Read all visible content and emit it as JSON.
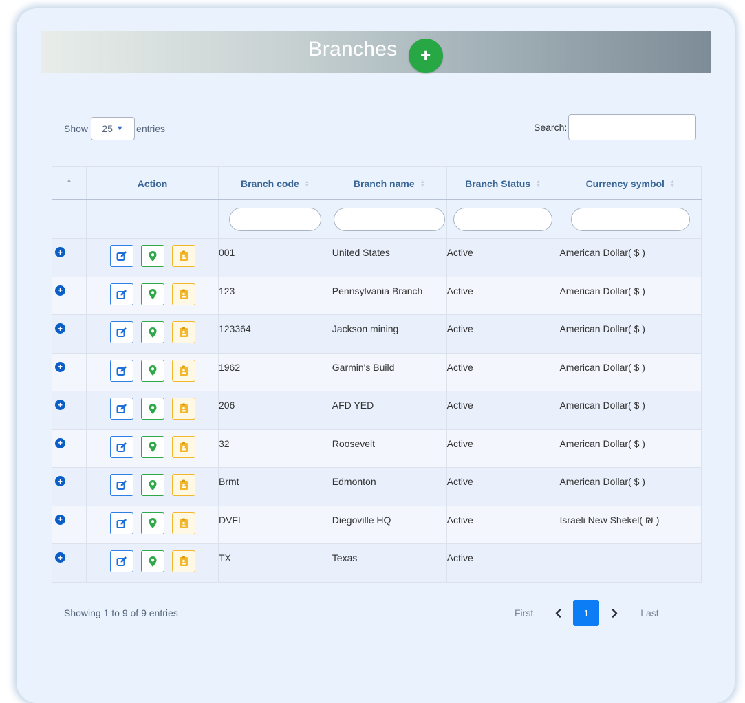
{
  "header": {
    "title": "Branches",
    "add_label": "+"
  },
  "controls": {
    "show_label": "Show",
    "entries_value": "25",
    "entries_label": "entries",
    "search_label": "Search:",
    "search_value": ""
  },
  "table": {
    "columns": [
      "",
      "Action",
      "Branch code",
      "Branch name",
      "Branch Status",
      "Currency symbol"
    ],
    "rows": [
      {
        "code": "001",
        "name": "United States",
        "status": "Active",
        "currency": "American Dollar( $ )"
      },
      {
        "code": "123",
        "name": "Pennsylvania Branch",
        "status": "Active",
        "currency": "American Dollar( $ )"
      },
      {
        "code": "123364",
        "name": "Jackson mining",
        "status": "Active",
        "currency": "American Dollar( $ )"
      },
      {
        "code": "1962",
        "name": "Garmin's Build",
        "status": "Active",
        "currency": "American Dollar( $ )"
      },
      {
        "code": "206",
        "name": "AFD YED",
        "status": "Active",
        "currency": "American Dollar( $ )"
      },
      {
        "code": "32",
        "name": "Roosevelt",
        "status": "Active",
        "currency": "American Dollar( $ )"
      },
      {
        "code": "Brmt",
        "name": "Edmonton",
        "status": "Active",
        "currency": "American Dollar( $ )"
      },
      {
        "code": "DVFL",
        "name": "Diegoville HQ",
        "status": "Active",
        "currency": "Israeli New Shekel( ₪ )"
      },
      {
        "code": "TX",
        "name": "Texas",
        "status": "Active",
        "currency": ""
      }
    ]
  },
  "footer": {
    "info": "Showing 1 to 9 of 9 entries",
    "first": "First",
    "current_page": "1",
    "last": "Last"
  },
  "icons": {
    "expand": "plus-circle-icon",
    "edit": "edit-icon",
    "location": "map-pin-icon",
    "badge": "id-badge-icon"
  },
  "colors": {
    "accent": "#0d7df5",
    "add": "#28a745",
    "edit": "#2f7fe6",
    "location": "#2fa84a",
    "badge": "#f3b72b"
  }
}
